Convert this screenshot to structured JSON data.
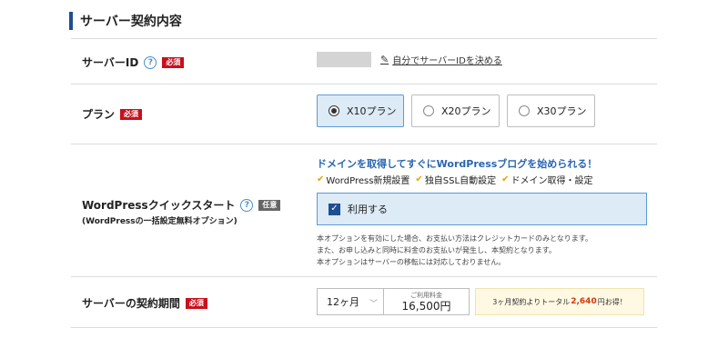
{
  "section": {
    "title": "サーバー契約内容"
  },
  "server_id": {
    "label": "サーバーID",
    "help": "?",
    "required_badge": "必須",
    "link_text": "自分でサーバーIDを決める",
    "link_icon": "pencil-icon"
  },
  "plan": {
    "label": "プラン",
    "required_badge": "必須",
    "options": [
      {
        "label": "X10プラン",
        "selected": true
      },
      {
        "label": "X20プラン",
        "selected": false
      },
      {
        "label": "X30プラン",
        "selected": false
      }
    ]
  },
  "quickstart": {
    "label": "WordPressクイックスタート",
    "help": "?",
    "optional_badge": "任意",
    "sublabel": "(WordPressの一括設定無料オプション)",
    "promo": "ドメインを取得してすぐにWordPressブログを始められる！",
    "features": [
      "WordPress新規設置",
      "独自SSL自動設定",
      "ドメイン取得・設定"
    ],
    "checkbox_label": "利用する",
    "checkbox_checked": true,
    "notes": [
      "本オプションを有効にした場合、お支払い方法はクレジットカードのみとなります。",
      "また、お申し込みと同時に料金のお支払いが発生し、本契約となります。",
      "本オプションはサーバーの移転には対応しておりません。"
    ]
  },
  "period": {
    "label": "サーバーの契約期間",
    "required_badge": "必須",
    "selected": "12ヶ月",
    "fee_label": "ご利用料金",
    "fee_value": "16,500円",
    "savings_prefix": "3ヶ月契約よりトータル",
    "savings_amount": "2,640",
    "savings_suffix": "円お得！"
  },
  "colors": {
    "accent": "#1d4f91",
    "required": "#c8101c",
    "selected_bg": "#ddebf7",
    "promo_text": "#2a66b0",
    "savings_amount": "#d23a0e"
  }
}
